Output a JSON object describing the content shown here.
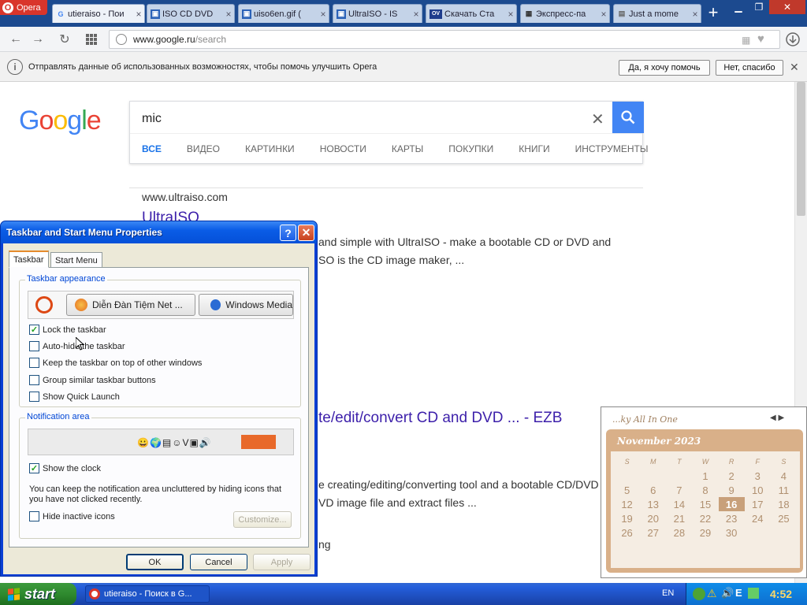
{
  "browser": {
    "menu_label": "Opera",
    "tabs": [
      {
        "title": "utieraiso - Пои",
        "active": true
      },
      {
        "title": "ISO CD DVD"
      },
      {
        "title": "uiso6en.gif ("
      },
      {
        "title": "UltraISO - IS"
      },
      {
        "title": "Скачать Ста"
      },
      {
        "title": "Экспресс-па"
      },
      {
        "title": "Just a mome"
      }
    ],
    "url_host": "www.google.ru",
    "url_path": "/search",
    "infobar_text": "Отправлять данные об использованных возможностях, чтобы помочь улучшить Opera",
    "infobar_yes": "Да, я хочу помочь",
    "infobar_no": "Нет, спасибо"
  },
  "google": {
    "logo": "Google",
    "query": "mic",
    "tabs": [
      "ВСЕ",
      "ВИДЕО",
      "КАРТИНКИ",
      "НОВОСТИ",
      "КАРТЫ",
      "ПОКУПКИ",
      "КНИГИ",
      "ИНСТРУМЕНТЫ"
    ],
    "result1_url": "www.ultraiso.com",
    "result1_title": "UltraISO",
    "result1_line1": "and simple with UltraISO - make a bootable CD or DVD and",
    "result1_line2": "SO is the CD image maker, ...",
    "result2_title": "te/edit/convert CD and DVD ... - EZB",
    "result2_line1": "e creating/editing/converting tool and a bootable CD/DVD",
    "result2_line2": "VD image file and extract files ...",
    "result2_line3": "ng"
  },
  "calendar": {
    "header": "...ky All In One",
    "month": "November 2023",
    "weekdays": [
      "S",
      "M",
      "T",
      "W",
      "R",
      "F",
      "S"
    ],
    "weeks": [
      [
        "",
        "",
        "",
        "1",
        "2",
        "3",
        "4"
      ],
      [
        "5",
        "6",
        "7",
        "8",
        "9",
        "10",
        "11"
      ],
      [
        "12",
        "13",
        "14",
        "15",
        "16",
        "17",
        "18"
      ],
      [
        "19",
        "20",
        "21",
        "22",
        "23",
        "24",
        "25"
      ],
      [
        "26",
        "27",
        "28",
        "29",
        "30",
        "",
        ""
      ]
    ],
    "today": "16"
  },
  "dialog": {
    "title": "Taskbar and Start Menu Properties",
    "tab_taskbar": "Taskbar",
    "tab_start": "Start Menu",
    "group_appearance": "Taskbar appearance",
    "preview_btn1": "Diễn Đàn Tiệm Net ...",
    "preview_btn2": "Windows Media",
    "cb_lock": "Lock the taskbar",
    "cb_autohide": "Auto-hide the taskbar",
    "cb_ontop": "Keep the taskbar on top of other windows",
    "cb_group": "Group similar taskbar buttons",
    "cb_quick": "Show Quick Launch",
    "group_notification": "Notification area",
    "cb_clock": "Show the clock",
    "note_text": "You can keep the notification area uncluttered by hiding icons that you have not clicked recently.",
    "cb_hide": "Hide inactive icons",
    "btn_customize": "Customize...",
    "btn_ok": "OK",
    "btn_cancel": "Cancel",
    "btn_apply": "Apply",
    "checked": {
      "lock": true,
      "autohide": false,
      "ontop": false,
      "group": false,
      "quick": false,
      "clock": true,
      "hide": false
    }
  },
  "taskbar": {
    "start_label": "start",
    "item_label": "utieraiso - Поиск в G...",
    "lang": "EN",
    "clock": "4:52"
  },
  "colors": {
    "xp_blue": "#0a5ce6",
    "google_blue": "#4285f4",
    "calendar_tan": "#d9b089"
  }
}
